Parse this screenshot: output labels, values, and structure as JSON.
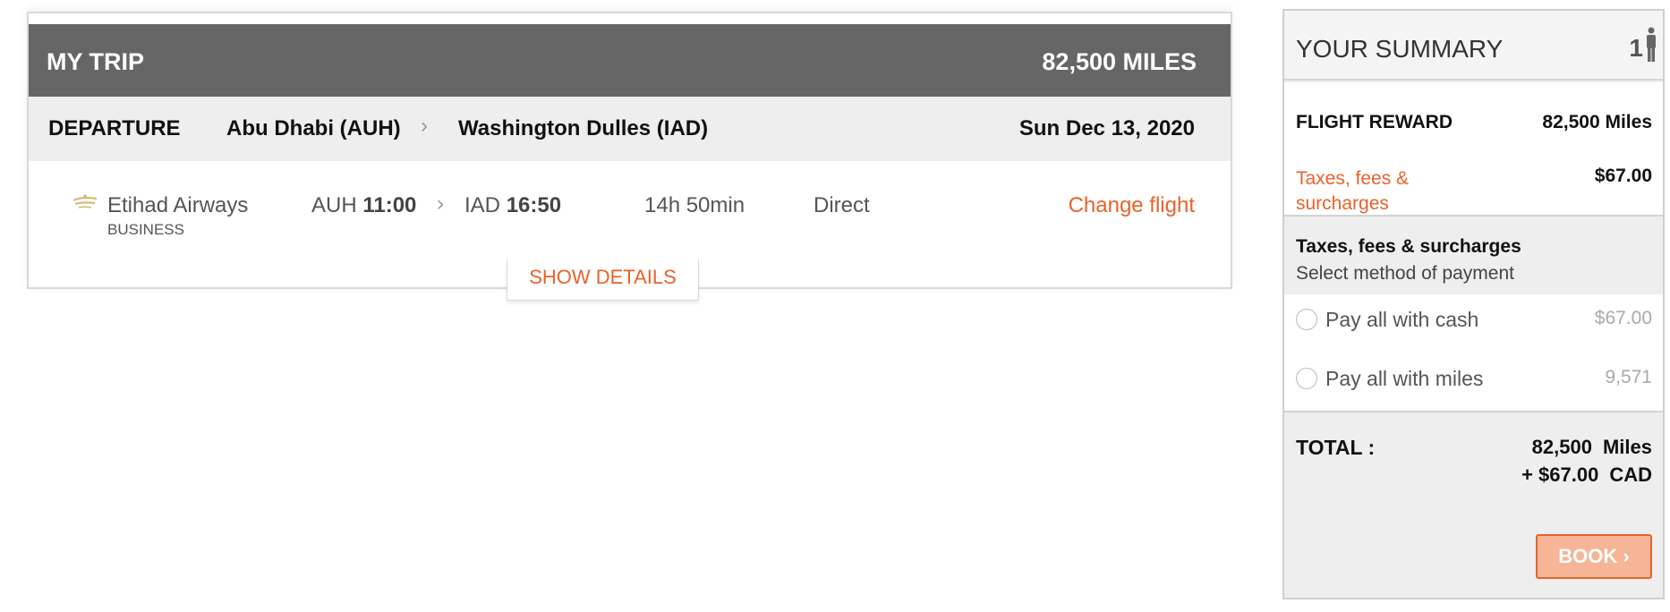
{
  "trip": {
    "title": "MY TRIP",
    "total_miles": "82,500 MILES",
    "departure": {
      "label": "DEPARTURE",
      "origin": "Abu Dhabi (AUH)",
      "arrow": "›",
      "destination": "Washington Dulles (IAD)",
      "date": "Sun Dec 13, 2020"
    },
    "segment": {
      "airline": "Etihad Airways",
      "cabin": "BUSINESS",
      "from_code": "AUH",
      "from_time": "11:00",
      "arrow": "›",
      "to_code": "IAD",
      "to_time": "16:50",
      "duration": "14h 50min",
      "stops": "Direct",
      "change_label": "Change flight"
    },
    "show_details_label": "SHOW DETAILS"
  },
  "summary": {
    "title": "YOUR SUMMARY",
    "passengers": "1",
    "flight_reward_label": "FLIGHT REWARD",
    "flight_reward_value": "82,500 Miles",
    "taxes_label": "Taxes, fees & surcharges",
    "taxes_value": "$67.00",
    "payment_title": "Taxes, fees & surcharges",
    "payment_subtitle": "Select method of payment",
    "options": [
      {
        "label": "Pay all with cash",
        "amount": "$67.00"
      },
      {
        "label": "Pay all with miles",
        "amount": "9,571"
      }
    ],
    "total_label": "TOTAL :",
    "total_miles_value": "82,500",
    "total_miles_unit": "Miles",
    "total_cash_value": "+ $67.00",
    "total_cash_unit": "CAD",
    "book_label": "BOOK ›"
  },
  "colors": {
    "accent": "#e8622c",
    "header_bg": "#666666",
    "row_bg": "#eeeeee",
    "book_bg": "#f6b597"
  }
}
